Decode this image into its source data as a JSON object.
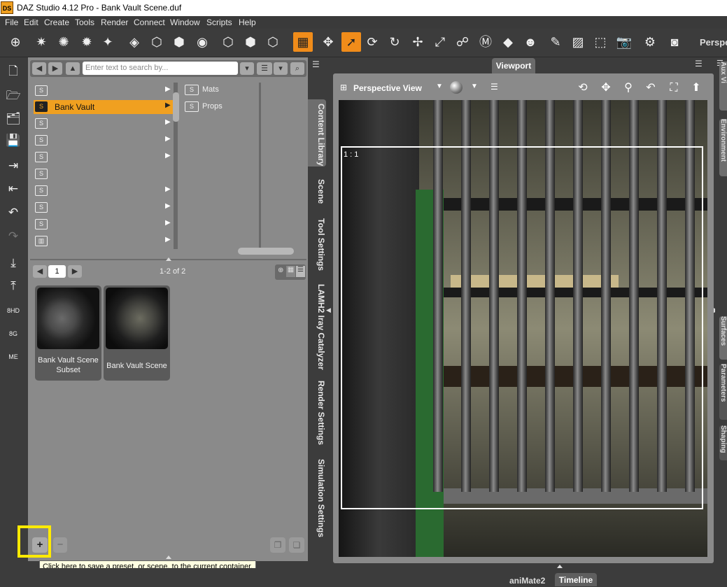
{
  "window": {
    "logo": "DS",
    "title": "DAZ Studio 4.12 Pro - Bank Vault Scene.duf"
  },
  "menu": [
    "File",
    "Edit",
    "Create",
    "Tools",
    "Render",
    "Connect",
    "Window",
    "Scripts",
    "Help"
  ],
  "toolbar": {
    "perspective_label": "Perspe"
  },
  "content_library": {
    "search_placeholder": "Enter text to search by...",
    "tree_selected": "Bank Vault",
    "subfolders": [
      "Mats",
      "Props"
    ],
    "page": "1",
    "page_count": "1-2 of 2",
    "items": [
      {
        "label": "Bank Vault Scene Subset"
      },
      {
        "label": "Bank Vault Scene"
      }
    ],
    "add_label": "+",
    "remove_label": "−"
  },
  "tooltip": "Click here to save a preset, or scene, to the current container.",
  "side_tabs": [
    "Content Library",
    "Scene",
    "Tool Settings",
    "LAMH2 Iray Catalyzer",
    "Render Settings",
    "Simulation Settings"
  ],
  "viewport": {
    "tab": "Viewport",
    "camera": "Perspective View",
    "ratio": "1 : 1"
  },
  "right_tabs": [
    "Aux Vi",
    "Environment",
    "Surfaces",
    "Parameters",
    "Shaping"
  ],
  "bottom_tabs": {
    "animate": "aniMate2",
    "timeline": "Timeline"
  },
  "accent_color": "#f0a020",
  "highlight_color": "#ffea00"
}
